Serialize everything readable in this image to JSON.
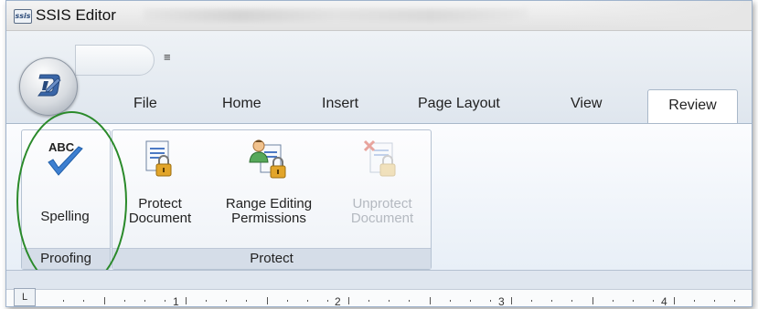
{
  "window": {
    "title": "SSIS Editor",
    "icon_text": "ssis"
  },
  "quick_access": {
    "dropdown_glyph": "≡"
  },
  "tabs": [
    {
      "label": "File"
    },
    {
      "label": "Home"
    },
    {
      "label": "Insert"
    },
    {
      "label": "Page Layout"
    },
    {
      "label": "View"
    },
    {
      "label": "Review",
      "active": true
    }
  ],
  "groups": {
    "proofing": {
      "label": "Proofing",
      "buttons": [
        {
          "label": "Spelling",
          "icon": "spelling-abc-check-icon",
          "enabled": true
        }
      ]
    },
    "protect": {
      "label": "Protect",
      "buttons": [
        {
          "label_line1": "Protect",
          "label_line2": "Document",
          "icon": "protect-document-lock-icon",
          "enabled": true
        },
        {
          "label_line1": "Range Editing",
          "label_line2": "Permissions",
          "icon": "range-editing-user-lock-icon",
          "enabled": true
        },
        {
          "label_line1": "Unprotect",
          "label_line2": "Document",
          "icon": "unprotect-document-icon",
          "enabled": false
        }
      ]
    }
  },
  "ruler": {
    "corner_glyph": "L",
    "numbers": [
      "1",
      "2",
      "3",
      "4"
    ]
  },
  "colors": {
    "highlight_ellipse": "#2a8a2a",
    "ribbon_border": "#a9b8c9",
    "check_blue": "#3d7fd1",
    "lock_gold": "#e2a52a"
  }
}
